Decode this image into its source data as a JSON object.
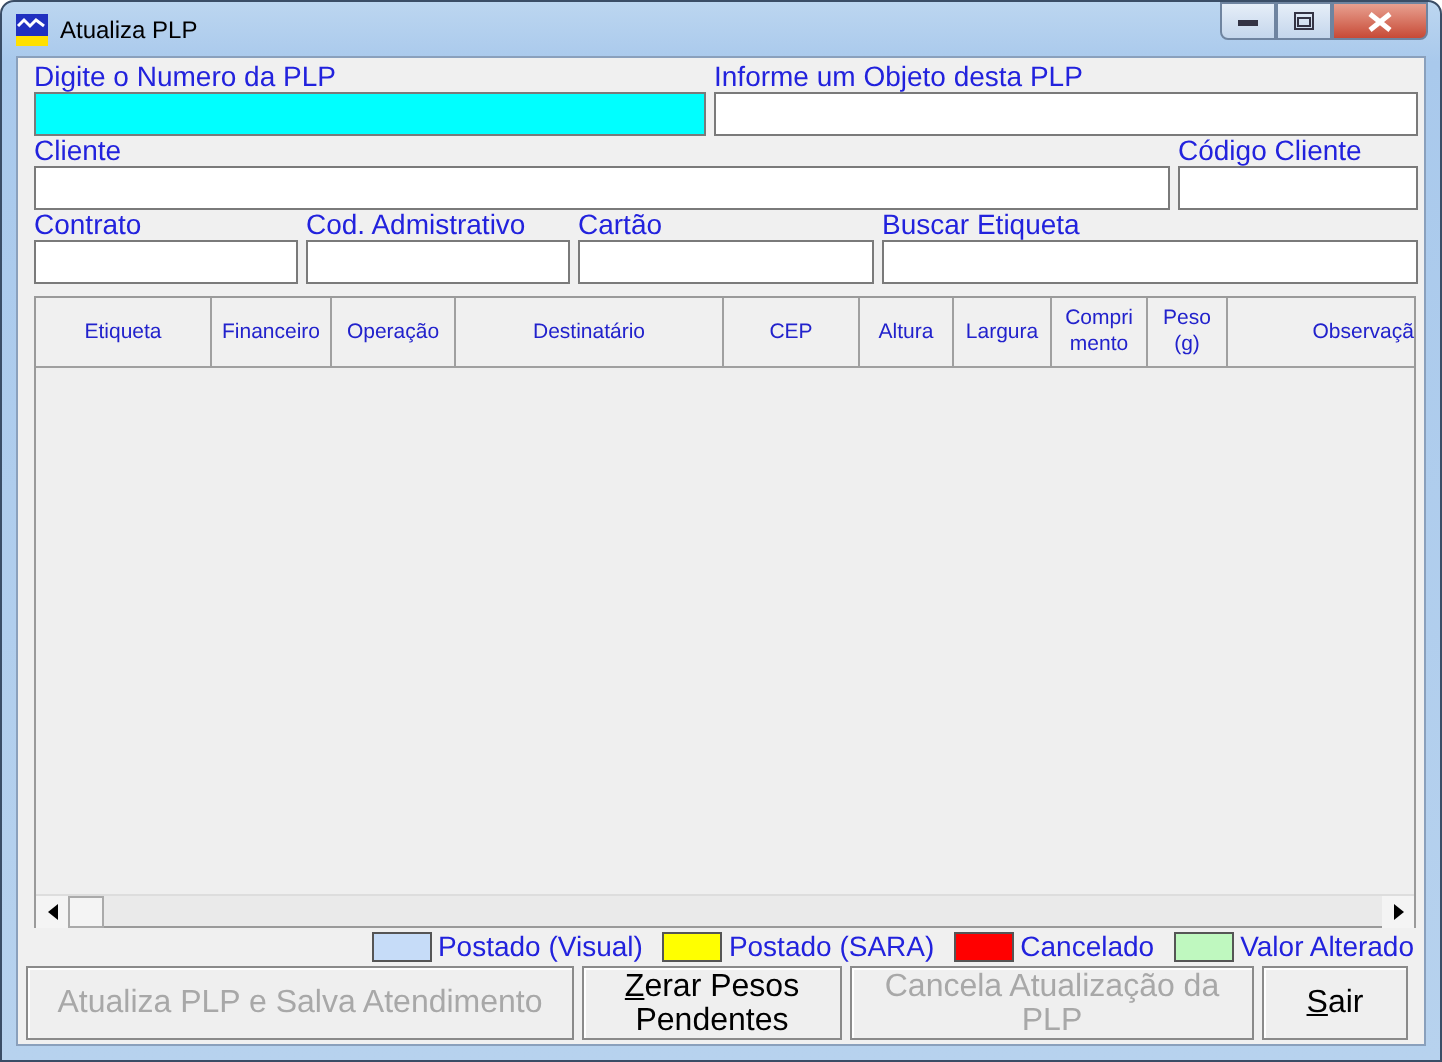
{
  "window": {
    "title": "Atualiza PLP"
  },
  "fields": [
    {
      "label": "Digite o Numero da PLP",
      "highlighted": true
    },
    {
      "label": "Informe um Objeto desta PLP",
      "highlighted": false
    },
    {
      "label": "Cliente",
      "highlighted": false
    },
    {
      "label": "Código Cliente",
      "highlighted": false
    },
    {
      "label": "Contrato",
      "highlighted": false
    },
    {
      "label": "Cod. Admistrativo",
      "highlighted": false
    },
    {
      "label": "Cartão",
      "highlighted": false
    },
    {
      "label": "Buscar Etiqueta",
      "highlighted": false
    }
  ],
  "table": {
    "columns": [
      "Etiqueta",
      "Financeiro",
      "Operação",
      "Destinatário",
      "CEP",
      "Altura",
      "Largura",
      "Comprimento",
      "Peso (g)",
      "Observaçã"
    ]
  },
  "legend": [
    {
      "label": "Postado (Visual)",
      "color": "#c6dcf8"
    },
    {
      "label": "Postado (SARA)",
      "color": "#ffff00"
    },
    {
      "label": "Cancelado",
      "color": "#ff0000"
    },
    {
      "label": "Valor Alterado",
      "color": "#bff8bf"
    }
  ],
  "buttons": [
    {
      "label": "Atualiza PLP e Salva Atendimento",
      "disabled": true,
      "underlined_first": false
    },
    {
      "label": "Zerar Pesos Pendentes",
      "disabled": false,
      "underlined_first": true
    },
    {
      "label": "Cancela Atualização da PLP",
      "disabled": true,
      "underlined_first": false
    },
    {
      "label": "Sair",
      "disabled": false,
      "underlined_first": true
    }
  ]
}
